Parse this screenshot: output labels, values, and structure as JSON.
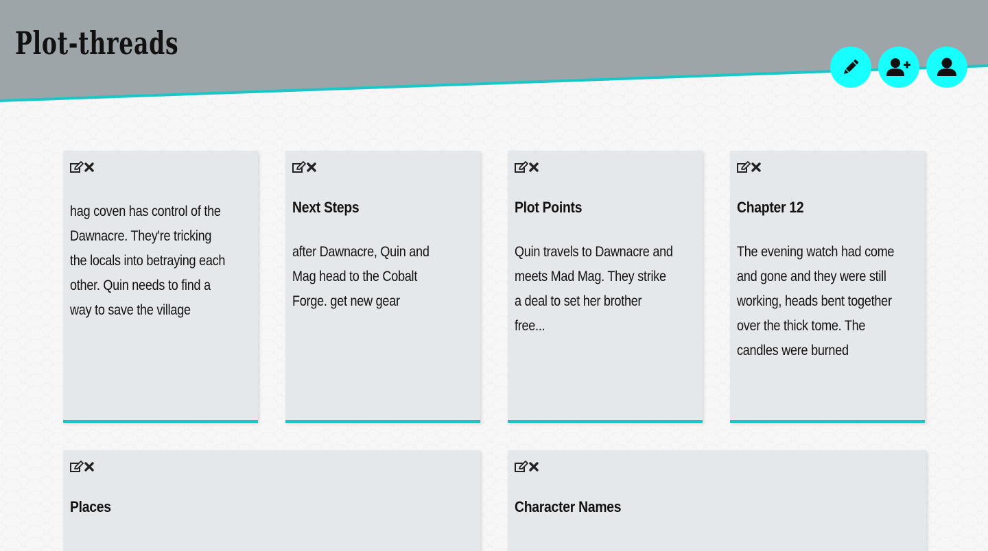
{
  "app": {
    "title": "Plot-threads"
  },
  "header": {
    "band_color": "#9da5a8",
    "accent_color": "#1bc6c6",
    "actions": [
      {
        "name": "new-thread-button",
        "icon": "pencil-icon"
      },
      {
        "name": "add-user-button",
        "icon": "user-plus-icon"
      },
      {
        "name": "profile-button",
        "icon": "user-icon"
      }
    ],
    "action_color": "#17ffff"
  },
  "cards": [
    {
      "title": "",
      "body": "hag coven has control of the Dawnacre. They're tricking the locals into betraying each other. Quin needs to find a way to save the village",
      "icons": [
        "edit-icon",
        "delete-icon"
      ]
    },
    {
      "title": "Next Steps",
      "body": "after Dawnacre, Quin and Mag head to the Cobalt Forge. get new gear",
      "icons": [
        "edit-icon",
        "delete-icon"
      ]
    },
    {
      "title": "Plot Points",
      "body": "Quin travels to Dawnacre and meets Mad Mag. They strike a deal to set her brother free...",
      "icons": [
        "edit-icon",
        "delete-icon"
      ]
    },
    {
      "title": "Chapter 12",
      "body": "The evening watch had come and gone and they were still working, heads bent together over the thick tome. The candles were burned",
      "icons": [
        "edit-icon",
        "delete-icon"
      ]
    },
    {
      "title": "Places",
      "body": "",
      "icons": [
        "edit-icon",
        "delete-icon"
      ]
    },
    {
      "title": "Character Names",
      "body": "",
      "icons": [
        "edit-icon",
        "delete-icon"
      ]
    }
  ],
  "card_color": "#e5e8eb"
}
